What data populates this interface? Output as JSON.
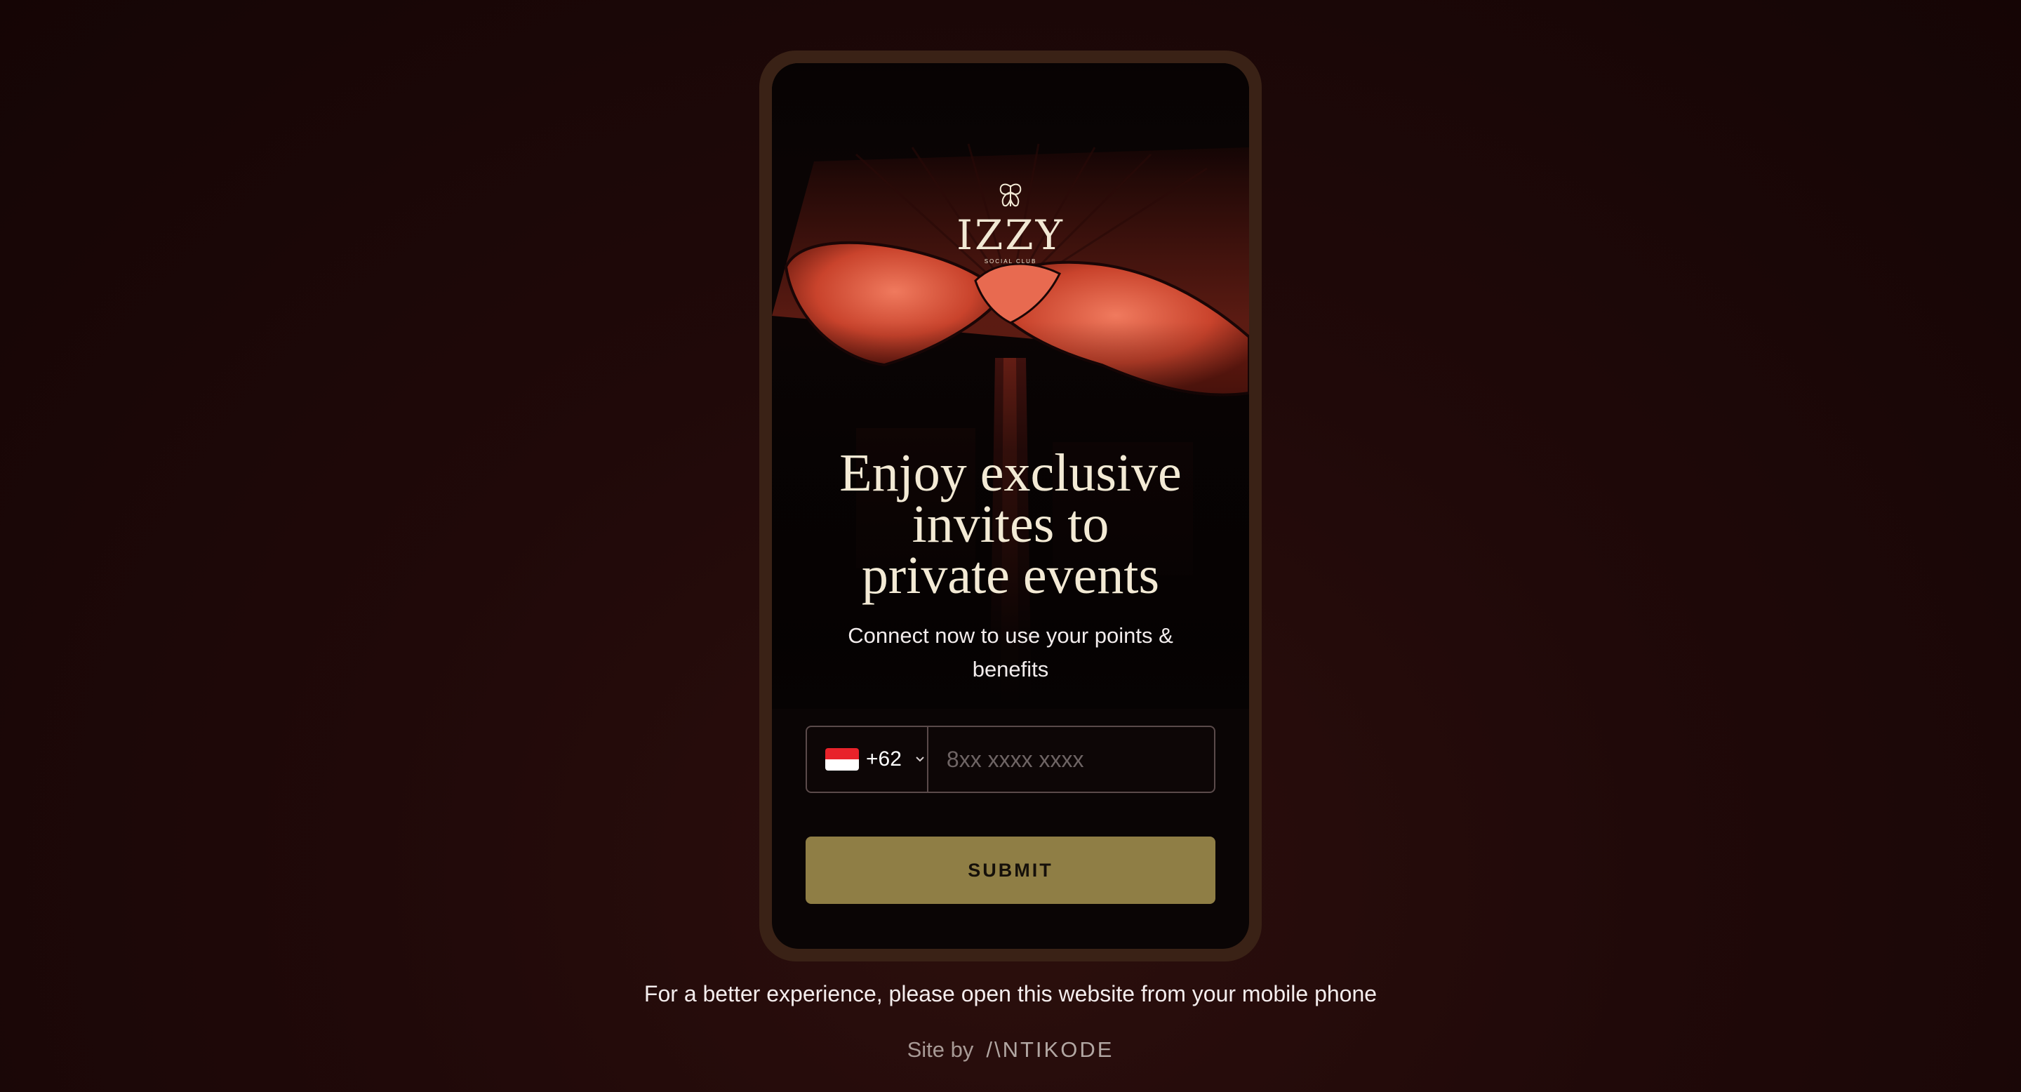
{
  "brand": {
    "logo_text": "IZZY",
    "logo_subtitle": "SOCIAL CLUB"
  },
  "hero": {
    "headline_lines": [
      "Enjoy exclusive",
      "invites to",
      "private events"
    ],
    "subtext": "Connect now to use your points & benefits"
  },
  "form": {
    "country_code": "+62",
    "country_flag": "indonesia-flag-icon",
    "phone_placeholder": "8xx xxxx xxxx",
    "submit_label": "SUBMIT"
  },
  "footer": {
    "notice": "For a better experience, please open this website from your mobile phone",
    "credit_prefix": "Site by",
    "credit_brand": "/\\NTIKODE"
  },
  "colors": {
    "accent_gold": "#8f7e45",
    "headline_cream": "#f3ead5",
    "frame_brown": "#3a2216",
    "background": "#200909"
  }
}
